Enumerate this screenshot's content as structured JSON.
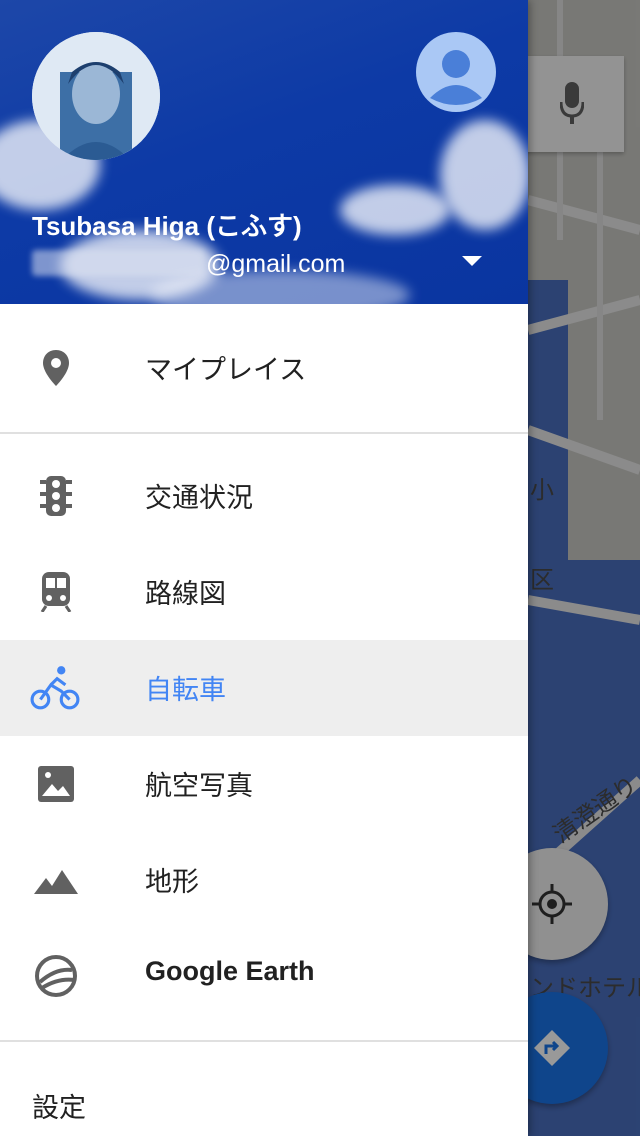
{
  "account": {
    "name": "Tsubasa Higa (こふす)",
    "email_visible": "@gmail.com"
  },
  "menu": {
    "my_places": "マイプレイス",
    "traffic": "交通状況",
    "transit": "路線図",
    "bicycling": "自転車",
    "satellite": "航空写真",
    "terrain": "地形",
    "google_earth": "Google Earth",
    "settings": "設定"
  },
  "map_labels": {
    "label_1": "小",
    "label_2": "区",
    "street": "清澄通り",
    "hotel": "ンドホテル"
  },
  "colors": {
    "accent": "#4285f4",
    "header_blue": "#0d3aa6",
    "icon_grey": "#616161"
  }
}
